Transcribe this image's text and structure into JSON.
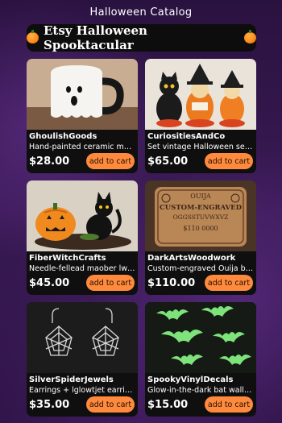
{
  "app": {
    "title": "Halloween Catalog",
    "banner": "Etsy Halloween Spooktacular"
  },
  "products": [
    {
      "seller": "GhoulishGoods",
      "desc": "Hand-painted ceramic mug(...",
      "price": "$28.00",
      "button": "add to cart"
    },
    {
      "seller": "CuriositiesAndCo",
      "desc": "Set vintage Halloween set glo...",
      "price": "$65.00",
      "button": "add to cart"
    },
    {
      "seller": "FiberWitchCrafts",
      "desc": "Needle-fellead maober lwafe...",
      "price": "$45.00",
      "button": "add to cart"
    },
    {
      "seller": "DarkArtsWoodwork",
      "desc": "Custom-engraved Ouija boar...",
      "price": "$110.00",
      "button": "add to cart"
    },
    {
      "seller": "SilverSpiderJewels",
      "desc": "Earrings + lglowtjet earrings ...",
      "price": "$35.00",
      "button": "add to cart"
    },
    {
      "seller": "SpookyVinylDecals",
      "desc": "Glow-in-the-dark bat wall dec...",
      "price": "$15.00",
      "button": "add to cart"
    }
  ],
  "ouija": {
    "brand": "OUIJA",
    "engraved_line1": "CUSTOM-ENGRAVED",
    "engraved_line2": "OGGSSTUVWXVZ",
    "numbers": "$110  0000"
  },
  "colors": {
    "accent": "#ff8a3d",
    "background": "#2a1240",
    "card": "#0f0f10"
  }
}
